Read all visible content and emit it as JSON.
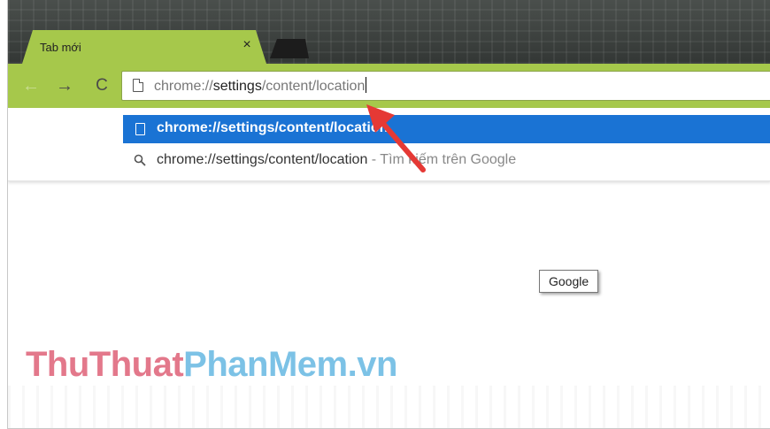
{
  "tab": {
    "title": "Tab mới",
    "close_glyph": "×"
  },
  "toolbar": {
    "back_glyph": "←",
    "forward_glyph": "→",
    "reload_glyph": "C"
  },
  "omnibox": {
    "scheme": "chrome://",
    "host": "settings",
    "path": "/content/location"
  },
  "suggestions": [
    {
      "icon": "page-icon",
      "text": "chrome://settings/content/location"
    },
    {
      "icon": "search-icon",
      "text": "chrome://settings/content/location",
      "separator": " - ",
      "hint": "Tìm kiếm trên Google"
    }
  ],
  "tooltip": {
    "text": "Google"
  },
  "watermark": {
    "part1": "ThuThuat",
    "part2": "PhanMem.vn"
  },
  "colors": {
    "theme_green": "#a6c84b",
    "selection_blue": "#1a73d4",
    "annotation_arrow": "#e53935"
  }
}
